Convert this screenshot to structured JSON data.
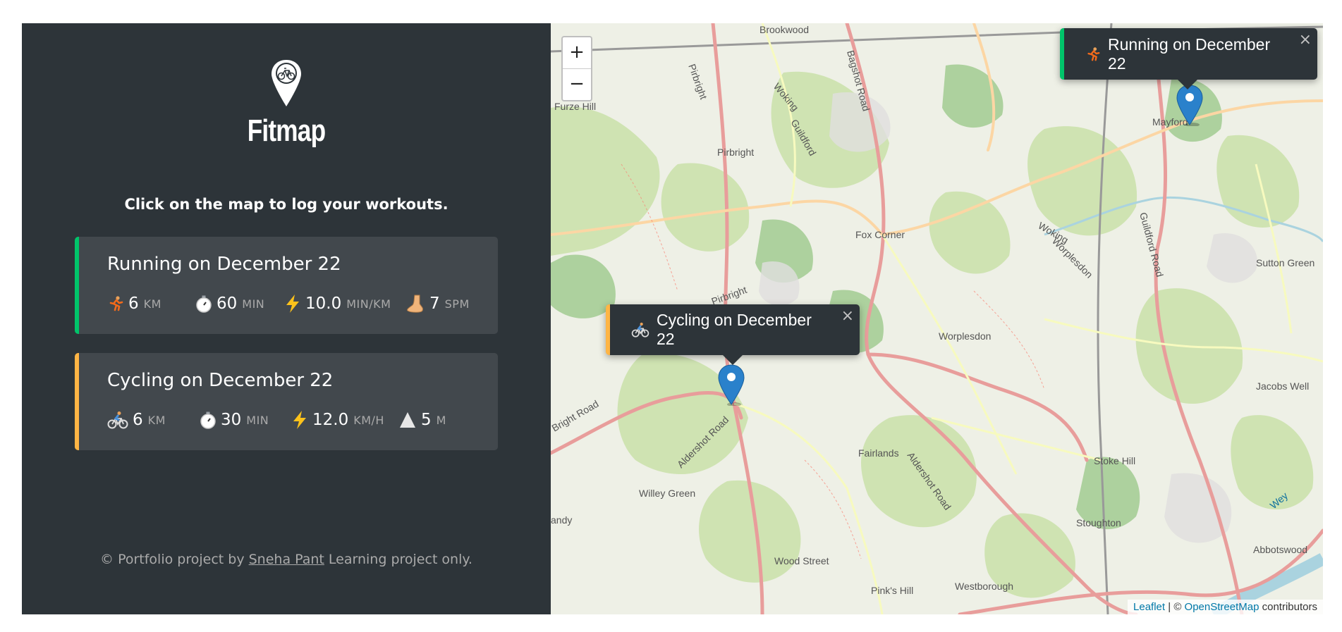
{
  "app": {
    "logo_text": "Fitmap",
    "instructions": "Click on the map to log your workouts.",
    "copyright_prefix": "© Portfolio project by",
    "copyright_author": "Sneha Pant",
    "copyright_suffix": "Learning project only."
  },
  "workouts": [
    {
      "type": "running",
      "title": "Running on December 22",
      "accent": "#00c46a",
      "stats": [
        {
          "icon": "running-icon",
          "value": "6",
          "unit": "KM"
        },
        {
          "icon": "stopwatch-icon",
          "value": "60",
          "unit": "MIN"
        },
        {
          "icon": "lightning-icon",
          "value": "10.0",
          "unit": "MIN/KM"
        },
        {
          "icon": "foot-icon",
          "value": "7",
          "unit": "SPM"
        }
      ]
    },
    {
      "type": "cycling",
      "title": "Cycling on December 22",
      "accent": "#ffb545",
      "stats": [
        {
          "icon": "cycling-icon",
          "value": "6",
          "unit": "KM"
        },
        {
          "icon": "stopwatch-icon",
          "value": "30",
          "unit": "MIN"
        },
        {
          "icon": "lightning-icon",
          "value": "12.0",
          "unit": "KM/H"
        },
        {
          "icon": "mountain-icon",
          "value": "5",
          "unit": "M"
        }
      ]
    }
  ],
  "map": {
    "zoom_in": "+",
    "zoom_out": "−",
    "popups": [
      {
        "label": "Running on December 22",
        "icon": "running-icon",
        "close": "×"
      },
      {
        "label": "Cycling on December 22",
        "icon": "cycling-icon",
        "close": "×"
      }
    ],
    "attribution": {
      "leaflet": "Leaflet",
      "separator": "| ©",
      "osm": "OpenStreetMap",
      "suffix": "contributors"
    },
    "place_labels": [
      "Brookwood",
      "Pirbright",
      "Furze Hill",
      "Bagshot Road",
      "Woking",
      "Guildford",
      "Pirbright",
      "Fox Corner",
      "Woking",
      "Worplesdon",
      "Guildford Road",
      "Mayford",
      "Sutton Green",
      "Worplesdon",
      "Jacobs Well",
      "Fairlands",
      "Aldershot Road",
      "Stoke Hill",
      "Willey Green",
      "Aldershot Road",
      "Wood Street",
      "Stoughton",
      "Pink's Hill",
      "Westborough",
      "Abbotswood",
      "Wey",
      "andy",
      "Bright Road",
      "Pirbright"
    ]
  }
}
